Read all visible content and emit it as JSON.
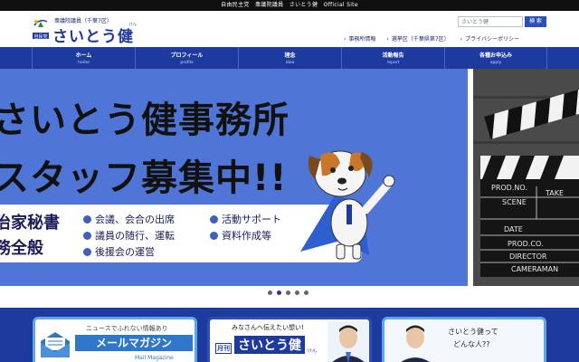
{
  "topbar": {
    "text": "自由民主党　衆議院議員　さいとう健　Official Site"
  },
  "header": {
    "logo_org": "自民党",
    "logo_subtitle": "衆議院議員（千葉7区）",
    "logo_name": "さいとう健",
    "logo_ruby": "けん",
    "search_placeholder": "さいとう健",
    "search_button": "検 索",
    "links": [
      {
        "label": "事務所情報"
      },
      {
        "label": "選挙区（千葉県第7区）"
      },
      {
        "label": "プライバシーポリシー"
      }
    ]
  },
  "nav": [
    {
      "label": "ホーム",
      "sub": "home"
    },
    {
      "label": "プロフィール",
      "sub": "profile"
    },
    {
      "label": "理念",
      "sub": "idea"
    },
    {
      "label": "活動報告",
      "sub": "report"
    },
    {
      "label": "各種お申込み",
      "sub": "apply"
    }
  ],
  "hero": {
    "headline1": "さいとう健事務所",
    "headline2": "スタッフ募集中!!",
    "left_job1": "治家秘書",
    "left_job2": "務全般",
    "duties": [
      "会議、会合の出席",
      "議員の随行、運転",
      "後援会の運営",
      "活動サポート",
      "資料作成等"
    ],
    "clapper": {
      "prod_no": "PROD.NO.",
      "scene": "SCENE",
      "take": "TAKE",
      "date": "DATE",
      "prod_co": "PROD.CO.",
      "director": "DIRECTOR",
      "cameraman": "CAMERAMAN"
    }
  },
  "slider_dots": {
    "count": 5,
    "active_index": 1
  },
  "banners": {
    "mail": {
      "note": "ニュースでふれない情報あり",
      "title": "メールマガジン",
      "en": "Mail Magazine"
    },
    "monthly": {
      "note": "みなさんへ伝えたい想い!",
      "prefix": "月刊",
      "title": "さいとう健",
      "ruby": "けん"
    },
    "who": {
      "text1": "さいとう健って",
      "text2": "どんな人??"
    }
  },
  "colors": {
    "brand": "#1d3a9e",
    "hero_bg": "#4f76d6",
    "accent_light": "#5da7e8",
    "dog_cape": "#2e5ed0"
  }
}
